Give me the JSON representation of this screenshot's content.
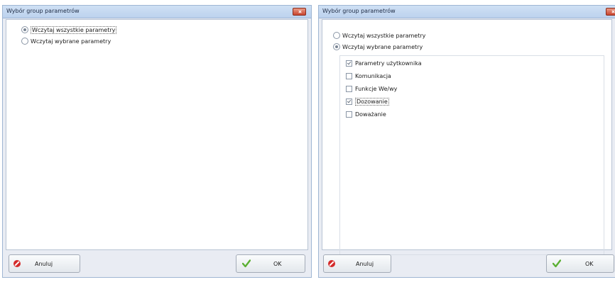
{
  "dialogs": [
    {
      "title": "Wybór group parametrów",
      "radios": [
        {
          "label": "Wczytaj wszystkie parametry",
          "selected": true
        },
        {
          "label": "Wczytaj wybrane parametry",
          "selected": false
        }
      ],
      "cancel_label": "Anuluj",
      "ok_label": "OK"
    },
    {
      "title": "Wybór group parametrów",
      "radios": [
        {
          "label": "Wczytaj wszystkie parametry",
          "selected": false
        },
        {
          "label": "Wczytaj wybrane parametry",
          "selected": true
        }
      ],
      "checkboxes": [
        {
          "label": "Parametry użytkownika",
          "checked": true
        },
        {
          "label": "Komunikacja",
          "checked": false
        },
        {
          "label": "Funkcje We/wy",
          "checked": false
        },
        {
          "label": "Dozowanie",
          "checked": true
        },
        {
          "label": "Doważanie",
          "checked": false
        }
      ],
      "cancel_label": "Anuluj",
      "ok_label": "OK"
    }
  ],
  "colors": {
    "titlebar": "#c5d9f1",
    "close_button": "#d9573f",
    "cancel_icon": "#d42b2b",
    "ok_icon": "#5bb033"
  },
  "icons": {
    "close": "close-icon",
    "cancel": "cancel-icon",
    "ok": "checkmark-icon"
  }
}
